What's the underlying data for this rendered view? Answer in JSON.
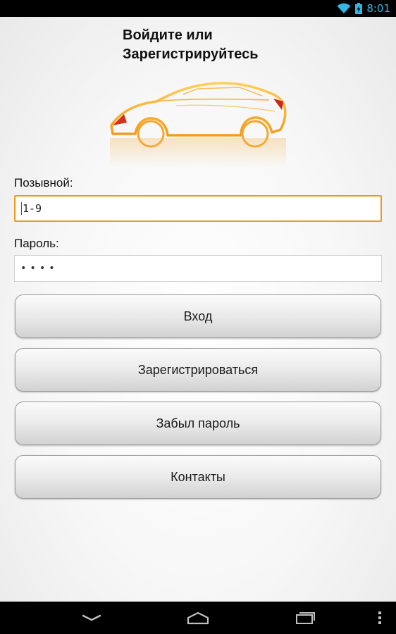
{
  "status_bar": {
    "time": "8:01",
    "icons": [
      "wifi-icon",
      "battery-charging-icon"
    ]
  },
  "login": {
    "title_line1": "Войдите или",
    "title_line2": "Зарегистрируйтесь",
    "logo": "car-outline-logo",
    "callsign_label": "Позывной:",
    "callsign_value": "1-9",
    "password_label": "Пароль:",
    "password_masked": "••••",
    "buttons": {
      "login": "Вход",
      "register": "Зарегистрироваться",
      "forgot": "Забыл пароль",
      "contacts": "Контакты"
    }
  },
  "nav_bar": {
    "icons": [
      "back-icon",
      "home-icon",
      "recent-apps-icon",
      "menu-icon"
    ]
  },
  "colors": {
    "accent_focus": "#f0981e",
    "status_blue": "#33b5e5"
  }
}
